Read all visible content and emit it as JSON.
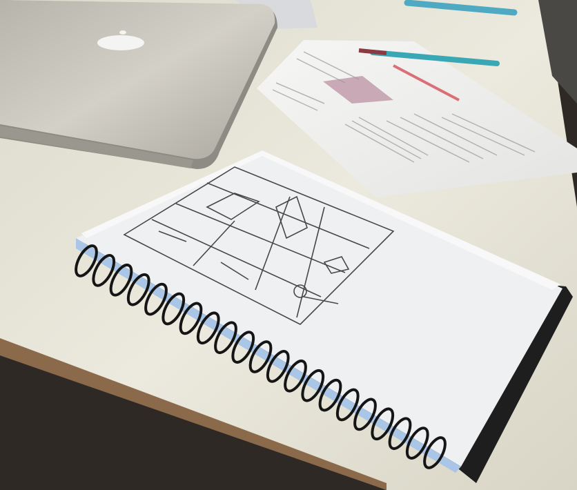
{
  "scene": {
    "colors": {
      "desk": "#e6e4d6",
      "desk_edge": "#8a6a4a",
      "floor": "#2e2925",
      "laptop": "#c9c6bd",
      "paper": "#f3f3f0",
      "notebook_page": "#f4f4f2",
      "spiral": "#151515",
      "pen": "#3aa7b5",
      "accent_red": "#d23a46"
    },
    "objects": [
      "laptop-icon",
      "apple-logo-icon",
      "document-sheet",
      "pen-icon",
      "spiral-notebook",
      "storyboard-sketch"
    ]
  }
}
